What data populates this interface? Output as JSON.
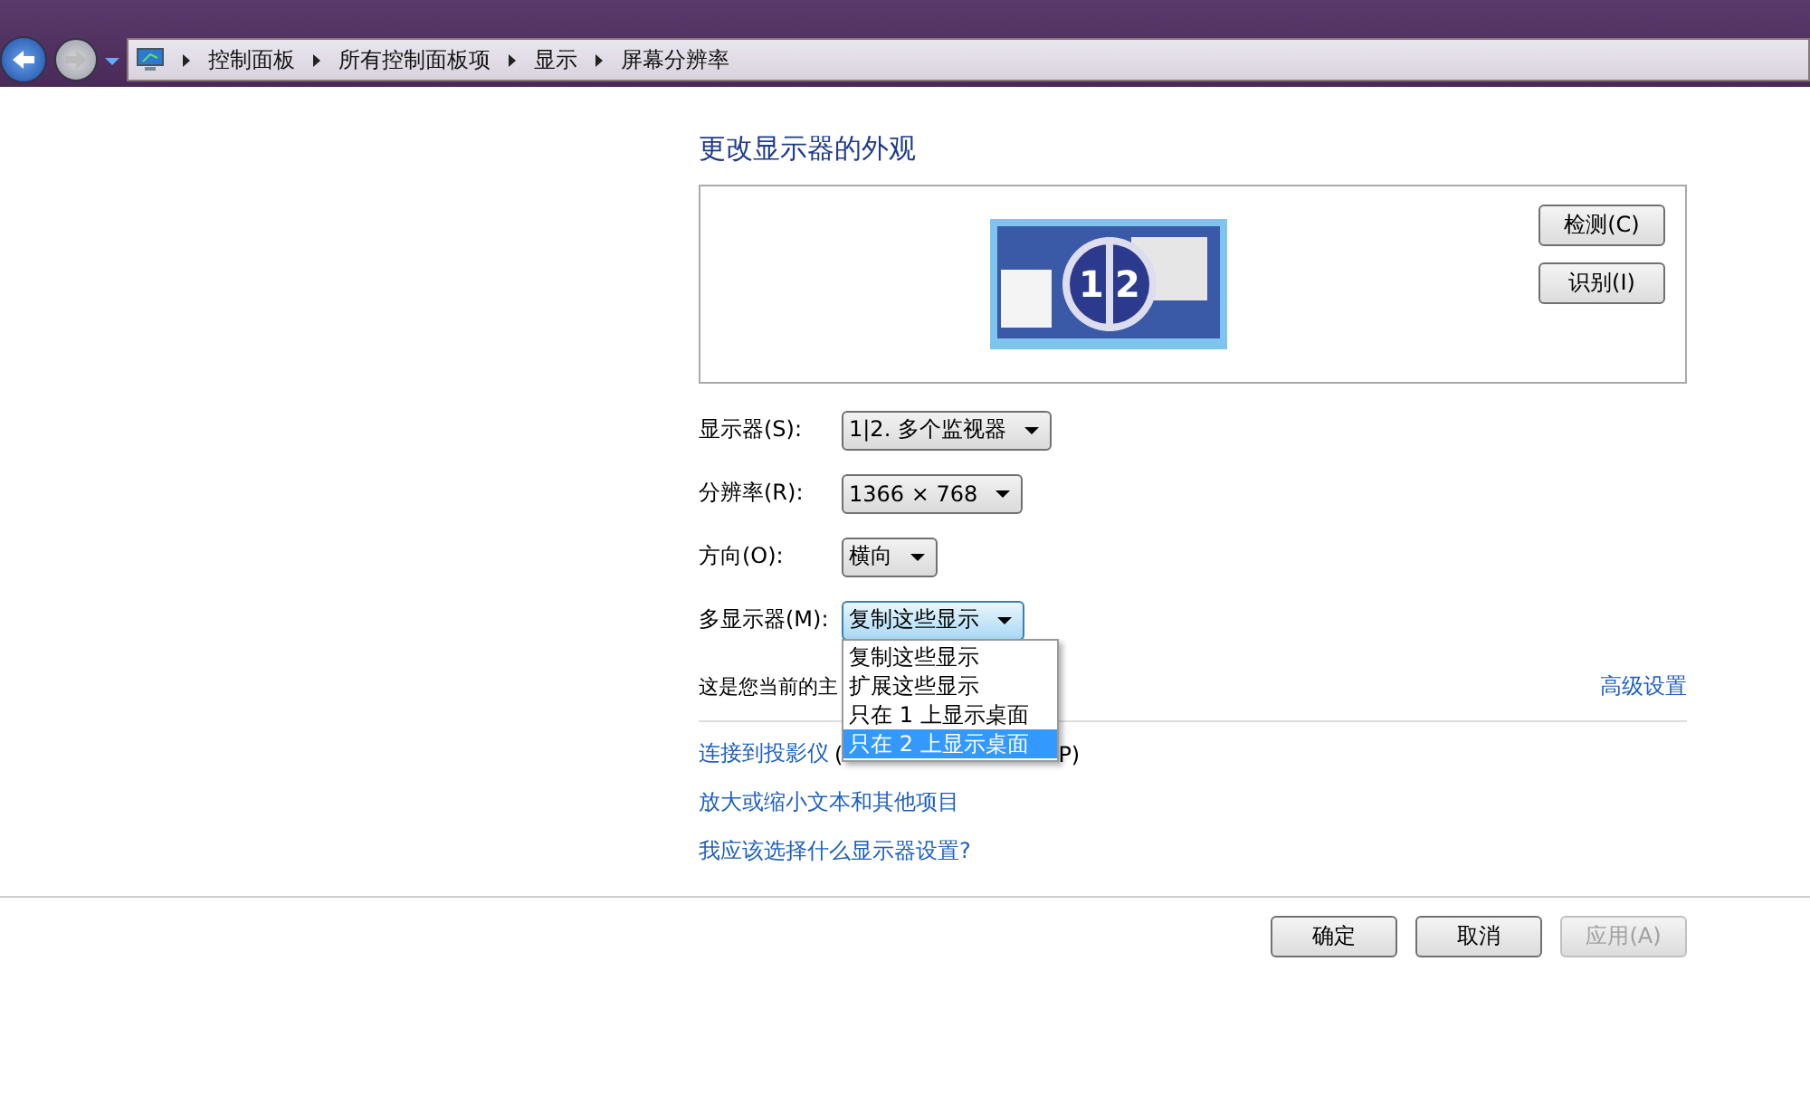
{
  "breadcrumb": [
    "控制面板",
    "所有控制面板项",
    "显示",
    "屏幕分辨率"
  ],
  "nav": {
    "back_disabled": false,
    "forward_disabled": true
  },
  "title": "更改显示器的外观",
  "preview": {
    "displays": [
      "1",
      "2"
    ],
    "buttons": [
      "检测(C)",
      "识别(I)"
    ]
  },
  "settings": [
    {
      "label": "显示器(S):",
      "value": "1|2. 多个监视器",
      "focused": false
    },
    {
      "label": "分辨率(R):",
      "value": "1366 × 768",
      "focused": false
    },
    {
      "label": "方向(O):",
      "value": "横向",
      "focused": false
    },
    {
      "label": "多显示器(M):",
      "value": "复制这些显示",
      "focused": true
    }
  ],
  "dropdown_options": [
    {
      "label": "复制这些显示",
      "selected": false
    },
    {
      "label": "扩展这些显示",
      "selected": false
    },
    {
      "label": "只在 1 上显示桌面",
      "selected": false
    },
    {
      "label": "只在 2 上显示桌面",
      "selected": true
    }
  ],
  "info_text": "这是您当前的主",
  "advanced_link": "高级设置",
  "projector": {
    "link": "连接到投影仪",
    "open": "(",
    "close": "P)"
  },
  "links": [
    "放大或缩小文本和其他项目",
    "我应该选择什么显示器设置?"
  ],
  "footer_buttons": [
    {
      "label": "确定",
      "disabled": false
    },
    {
      "label": "取消",
      "disabled": false
    },
    {
      "label": "应用(A)",
      "disabled": true
    }
  ]
}
